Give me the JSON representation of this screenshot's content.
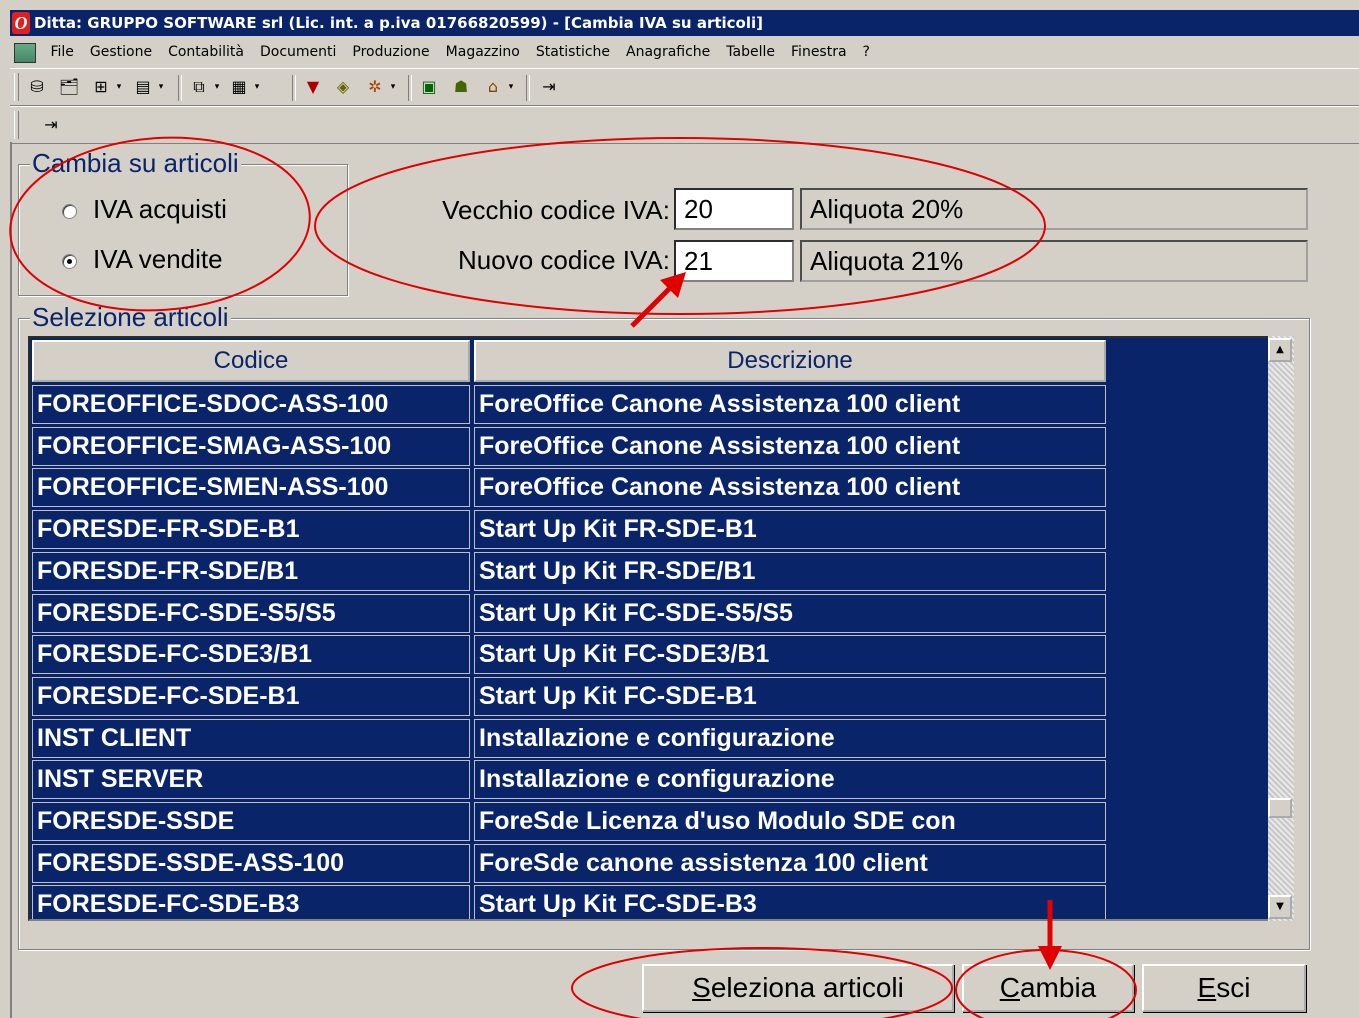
{
  "window": {
    "title": "Ditta: GRUPPO SOFTWARE srl (Lic. int. a p.iva 01766820599) - [Cambia IVA su articoli]"
  },
  "menu": [
    "File",
    "Gestione",
    "Contabilità",
    "Documenti",
    "Produzione",
    "Magazzino",
    "Statistiche",
    "Anagrafiche",
    "Tabelle",
    "Finestra",
    "?"
  ],
  "change_group": {
    "legend": "Cambia su articoli",
    "options": [
      {
        "label": "IVA acquisti",
        "selected": false
      },
      {
        "label": "IVA vendite",
        "selected": true
      }
    ]
  },
  "vat": {
    "old_label": "Vecchio codice IVA:",
    "old_code": "20",
    "old_desc": "Aliquota 20%",
    "new_label": "Nuovo codice IVA:",
    "new_code": "21",
    "new_desc": "Aliquota 21%"
  },
  "selection": {
    "legend": "Selezione articoli",
    "columns": [
      "Codice",
      "Descrizione"
    ],
    "rows": [
      [
        "FOREOFFICE-SDOC-ASS-100",
        "ForeOffice Canone Assistenza 100 client"
      ],
      [
        "FOREOFFICE-SMAG-ASS-100",
        "ForeOffice Canone Assistenza 100 client"
      ],
      [
        "FOREOFFICE-SMEN-ASS-100",
        "ForeOffice Canone Assistenza 100 client"
      ],
      [
        "FORESDE-FR-SDE-B1",
        "Start Up Kit FR-SDE-B1"
      ],
      [
        "FORESDE-FR-SDE/B1",
        "Start Up Kit FR-SDE/B1"
      ],
      [
        "FORESDE-FC-SDE-S5/S5",
        "Start Up Kit FC-SDE-S5/S5"
      ],
      [
        "FORESDE-FC-SDE3/B1",
        "Start Up Kit FC-SDE3/B1"
      ],
      [
        "FORESDE-FC-SDE-B1",
        "Start Up Kit FC-SDE-B1"
      ],
      [
        "INST CLIENT",
        "Installazione e configurazione"
      ],
      [
        "INST SERVER",
        "Installazione e configurazione"
      ],
      [
        "FORESDE-SSDE",
        "ForeSde Licenza d'uso Modulo SDE con"
      ],
      [
        "FORESDE-SSDE-ASS-100",
        "ForeSde canone assistenza 100 client"
      ],
      [
        "FORESDE-FC-SDE-B3",
        "Start Up Kit FC-SDE-B3"
      ]
    ],
    "scroll_position": 0.85
  },
  "buttons": {
    "select": {
      "mnemonic": "S",
      "rest": "eleziona articoli"
    },
    "change": {
      "mnemonic": "C",
      "rest": "ambia"
    },
    "exit": {
      "mnemonic": "E",
      "rest": "sci"
    }
  },
  "colors": {
    "selection_bg": "#0a246a",
    "annotation": "#e00000",
    "face": "#d4d0c8"
  }
}
